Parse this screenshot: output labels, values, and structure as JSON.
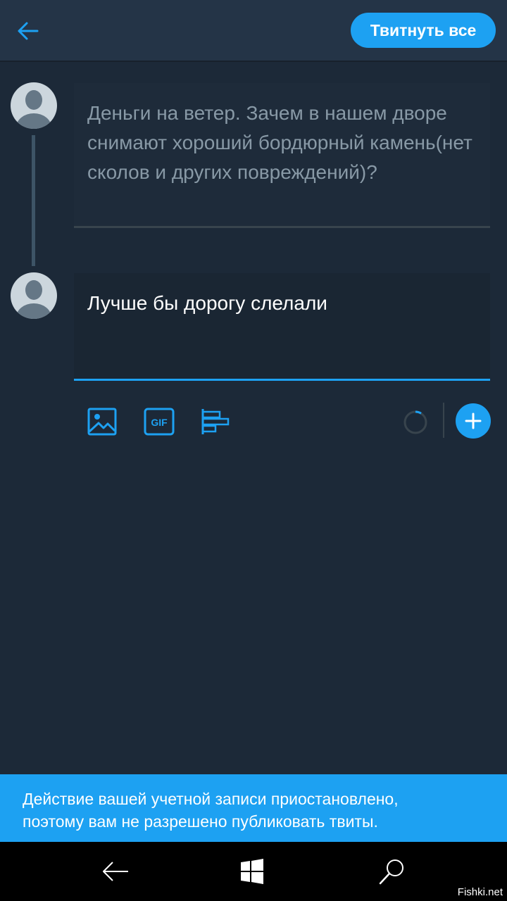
{
  "header": {
    "back_icon": "arrow-left-icon",
    "tweet_all_label": "Твитнуть все"
  },
  "thread": {
    "drafts": [
      {
        "text": "Деньги на ветер. Зачем в нашем дворе снимают хороший бордюрный камень(нет сколов и других повреждений)?",
        "active": false
      },
      {
        "text": "Лучше бы дорогу слелали",
        "active": true
      }
    ]
  },
  "toolbar": {
    "icons": [
      "image-icon",
      "gif-icon",
      "poll-icon"
    ],
    "gif_label": "GIF",
    "add_icon": "plus-icon"
  },
  "banner": {
    "line1": "Действие вашей учетной записи приостановлено,",
    "line2": "поэтому вам не разрешено публиковать твиты."
  },
  "navbar": {
    "icons": [
      "back-icon",
      "windows-icon",
      "search-icon"
    ]
  },
  "watermark": "Fishki.net",
  "colors": {
    "accent": "#1da1f2",
    "background": "#1c2938",
    "header": "#243447"
  }
}
